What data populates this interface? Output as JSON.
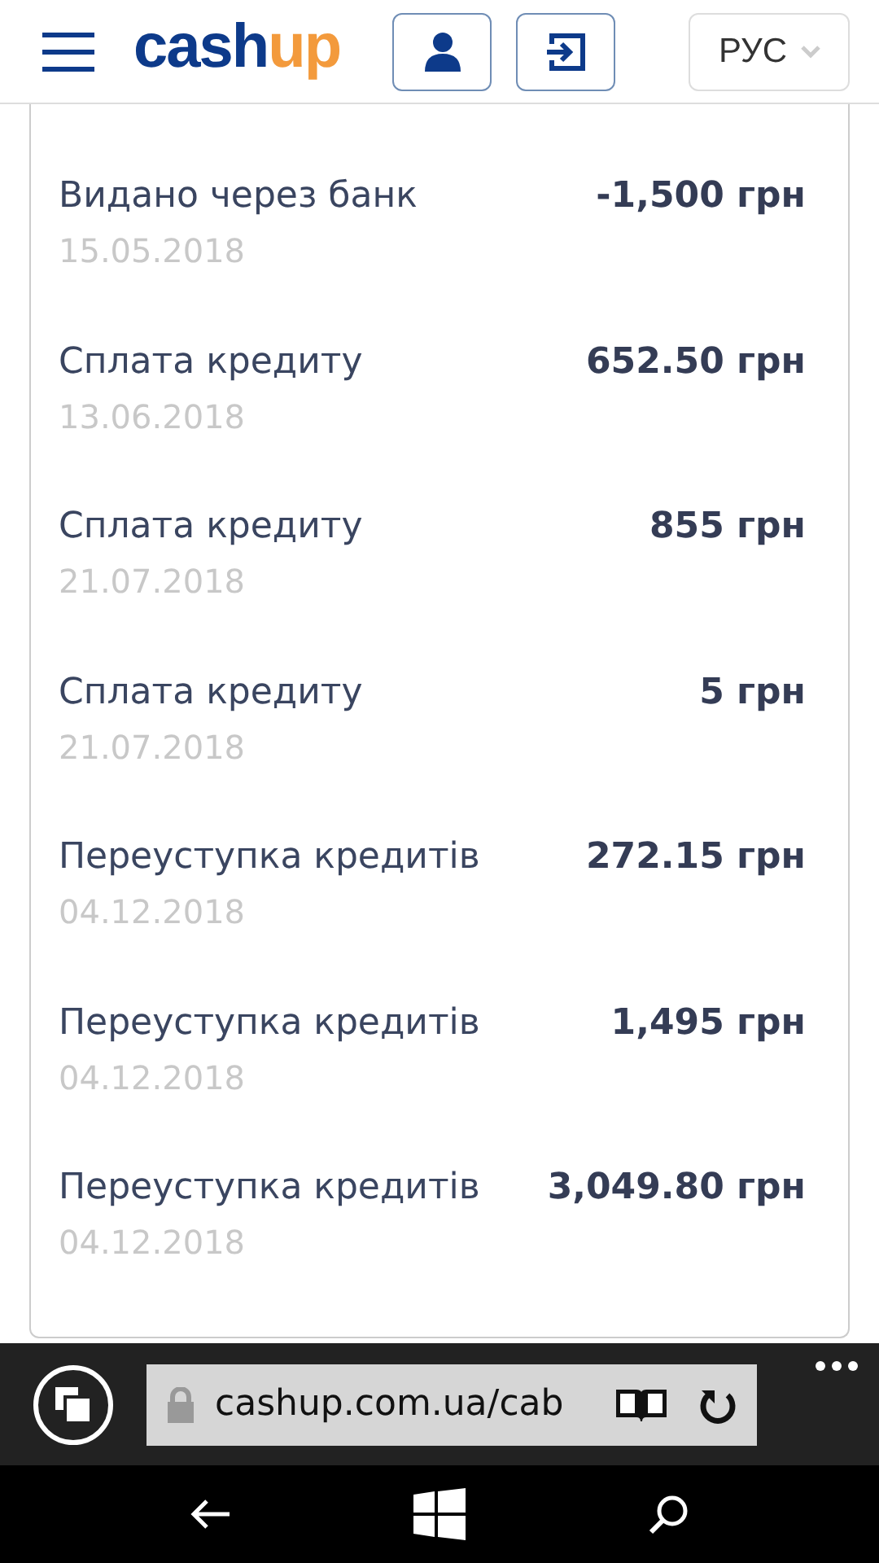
{
  "header": {
    "logo": {
      "primary": "cash",
      "accent": "up"
    },
    "language": "РУС"
  },
  "transactions": [
    {
      "title": "Видано через банк",
      "date": "15.05.2018",
      "amount": "-1,500 грн"
    },
    {
      "title": "Сплата кредиту",
      "date": "13.06.2018",
      "amount": "652.50 грн"
    },
    {
      "title": "Сплата кредиту",
      "date": "21.07.2018",
      "amount": "855 грн"
    },
    {
      "title": "Сплата кредиту",
      "date": "21.07.2018",
      "amount": "5 грн"
    },
    {
      "title": "Переуступка кредитів",
      "date": "04.12.2018",
      "amount": "272.15 грн"
    },
    {
      "title": "Переуступка кредитів",
      "date": "04.12.2018",
      "amount": "1,495 грн"
    },
    {
      "title": "Переуступка кредитів",
      "date": "04.12.2018",
      "amount": "3,049.80 грн"
    }
  ],
  "browser": {
    "url": "cashup.com.ua/cab"
  }
}
